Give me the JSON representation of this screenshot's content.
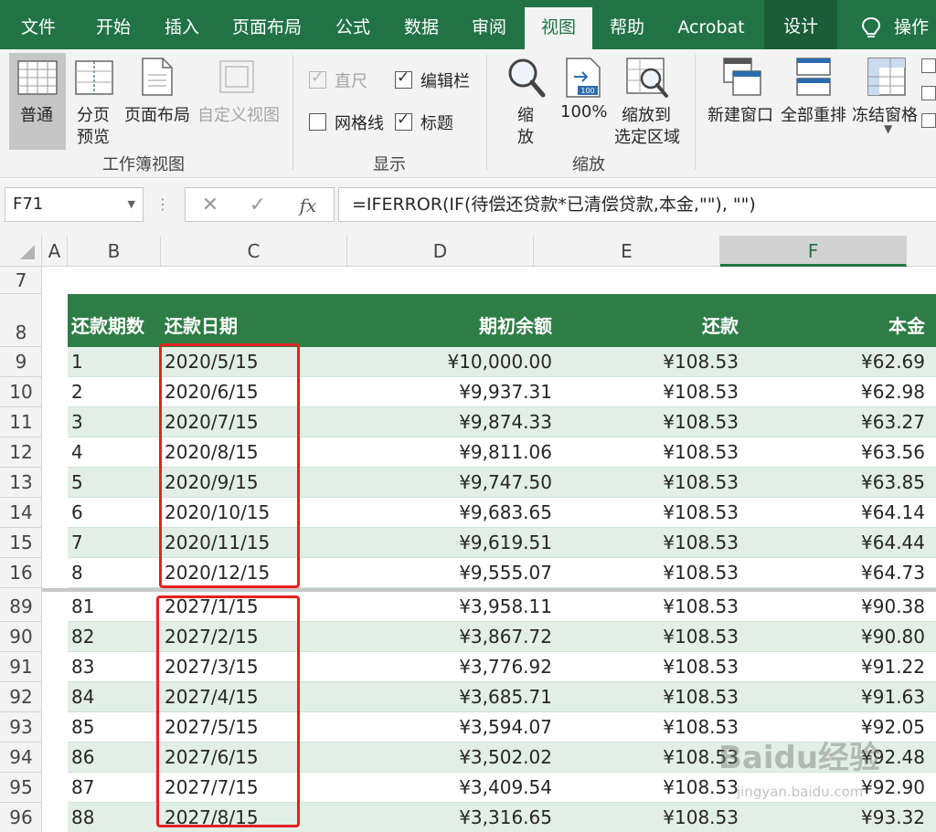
{
  "ribbon_tabs": [
    "文件",
    "开始",
    "插入",
    "页面布局",
    "公式",
    "数据",
    "审阅",
    "视图",
    "帮助",
    "Acrobat",
    "设计",
    "操作说"
  ],
  "active_tab": "视图",
  "ribbon": {
    "workbook_views": {
      "title": "工作簿视图",
      "normal": "普通",
      "page_break_1": "分页",
      "page_break_2": "预览",
      "page_layout": "页面布局",
      "custom_views": "自定义视图"
    },
    "show": {
      "title": "显示",
      "ruler": "直尺",
      "formula_bar": "编辑栏",
      "gridlines": "网格线",
      "headings": "标题"
    },
    "zoom": {
      "title": "缩放",
      "zoom_1": "缩",
      "zoom_2": "放",
      "hundred": "100%",
      "to_sel_1": "缩放到",
      "to_sel_2": "选定区域"
    },
    "window": {
      "new_window": "新建窗口",
      "arrange_all": "全部重排",
      "freeze_panes": "冻结窗格"
    },
    "checks": {
      "ruler": true,
      "formula_bar": true,
      "gridlines": false,
      "headings": true
    }
  },
  "formula_bar": {
    "name_box": "F71",
    "cancel": "✕",
    "enter": "✓",
    "fx": "fx",
    "formula": "=IFERROR(IF(待偿还贷款*已清偿贷款,本金,\"\"), \"\")"
  },
  "columns": [
    "A",
    "B",
    "C",
    "D",
    "E",
    "F"
  ],
  "selected_column": "F",
  "row_numbers": [
    "7",
    "8",
    "9",
    "10",
    "11",
    "12",
    "13",
    "14",
    "15",
    "16",
    "89",
    "90",
    "91",
    "92",
    "93",
    "94",
    "95",
    "96"
  ],
  "table_header": {
    "period": "还款期数",
    "date": "还款日期",
    "opening_balance": "期初余额",
    "payment": "还款",
    "principal": "本金"
  },
  "rows_top": [
    {
      "period": "1",
      "date": "2020/5/15",
      "balance": "¥10,000.00",
      "payment": "¥108.53",
      "principal": "¥62.69"
    },
    {
      "period": "2",
      "date": "2020/6/15",
      "balance": "¥9,937.31",
      "payment": "¥108.53",
      "principal": "¥62.98"
    },
    {
      "period": "3",
      "date": "2020/7/15",
      "balance": "¥9,874.33",
      "payment": "¥108.53",
      "principal": "¥63.27"
    },
    {
      "period": "4",
      "date": "2020/8/15",
      "balance": "¥9,811.06",
      "payment": "¥108.53",
      "principal": "¥63.56"
    },
    {
      "period": "5",
      "date": "2020/9/15",
      "balance": "¥9,747.50",
      "payment": "¥108.53",
      "principal": "¥63.85"
    },
    {
      "period": "6",
      "date": "2020/10/15",
      "balance": "¥9,683.65",
      "payment": "¥108.53",
      "principal": "¥64.14"
    },
    {
      "period": "7",
      "date": "2020/11/15",
      "balance": "¥9,619.51",
      "payment": "¥108.53",
      "principal": "¥64.44"
    },
    {
      "period": "8",
      "date": "2020/12/15",
      "balance": "¥9,555.07",
      "payment": "¥108.53",
      "principal": "¥64.73"
    }
  ],
  "rows_bottom": [
    {
      "period": "81",
      "date": "2027/1/15",
      "balance": "¥3,958.11",
      "payment": "¥108.53",
      "principal": "¥90.38"
    },
    {
      "period": "82",
      "date": "2027/2/15",
      "balance": "¥3,867.72",
      "payment": "¥108.53",
      "principal": "¥90.80"
    },
    {
      "period": "83",
      "date": "2027/3/15",
      "balance": "¥3,776.92",
      "payment": "¥108.53",
      "principal": "¥91.22"
    },
    {
      "period": "84",
      "date": "2027/4/15",
      "balance": "¥3,685.71",
      "payment": "¥108.53",
      "principal": "¥91.63"
    },
    {
      "period": "85",
      "date": "2027/5/15",
      "balance": "¥3,594.07",
      "payment": "¥108.53",
      "principal": "¥92.05"
    },
    {
      "period": "86",
      "date": "2027/6/15",
      "balance": "¥3,502.02",
      "payment": "¥108.53",
      "principal": "¥92.48"
    },
    {
      "period": "87",
      "date": "2027/7/15",
      "balance": "¥3,409.54",
      "payment": "¥108.53",
      "principal": "¥92.90"
    },
    {
      "period": "88",
      "date": "2027/8/15",
      "balance": "¥3,316.65",
      "payment": "¥108.53",
      "principal": "¥93.32"
    }
  ],
  "watermark": {
    "brand": "Baidu经验",
    "url": "jingyan.baidu.com"
  },
  "colors": {
    "ribbon_green": "#217346",
    "header_green": "#2e7d46",
    "band": "#e2efe6",
    "highlight_red": "#e52121"
  }
}
